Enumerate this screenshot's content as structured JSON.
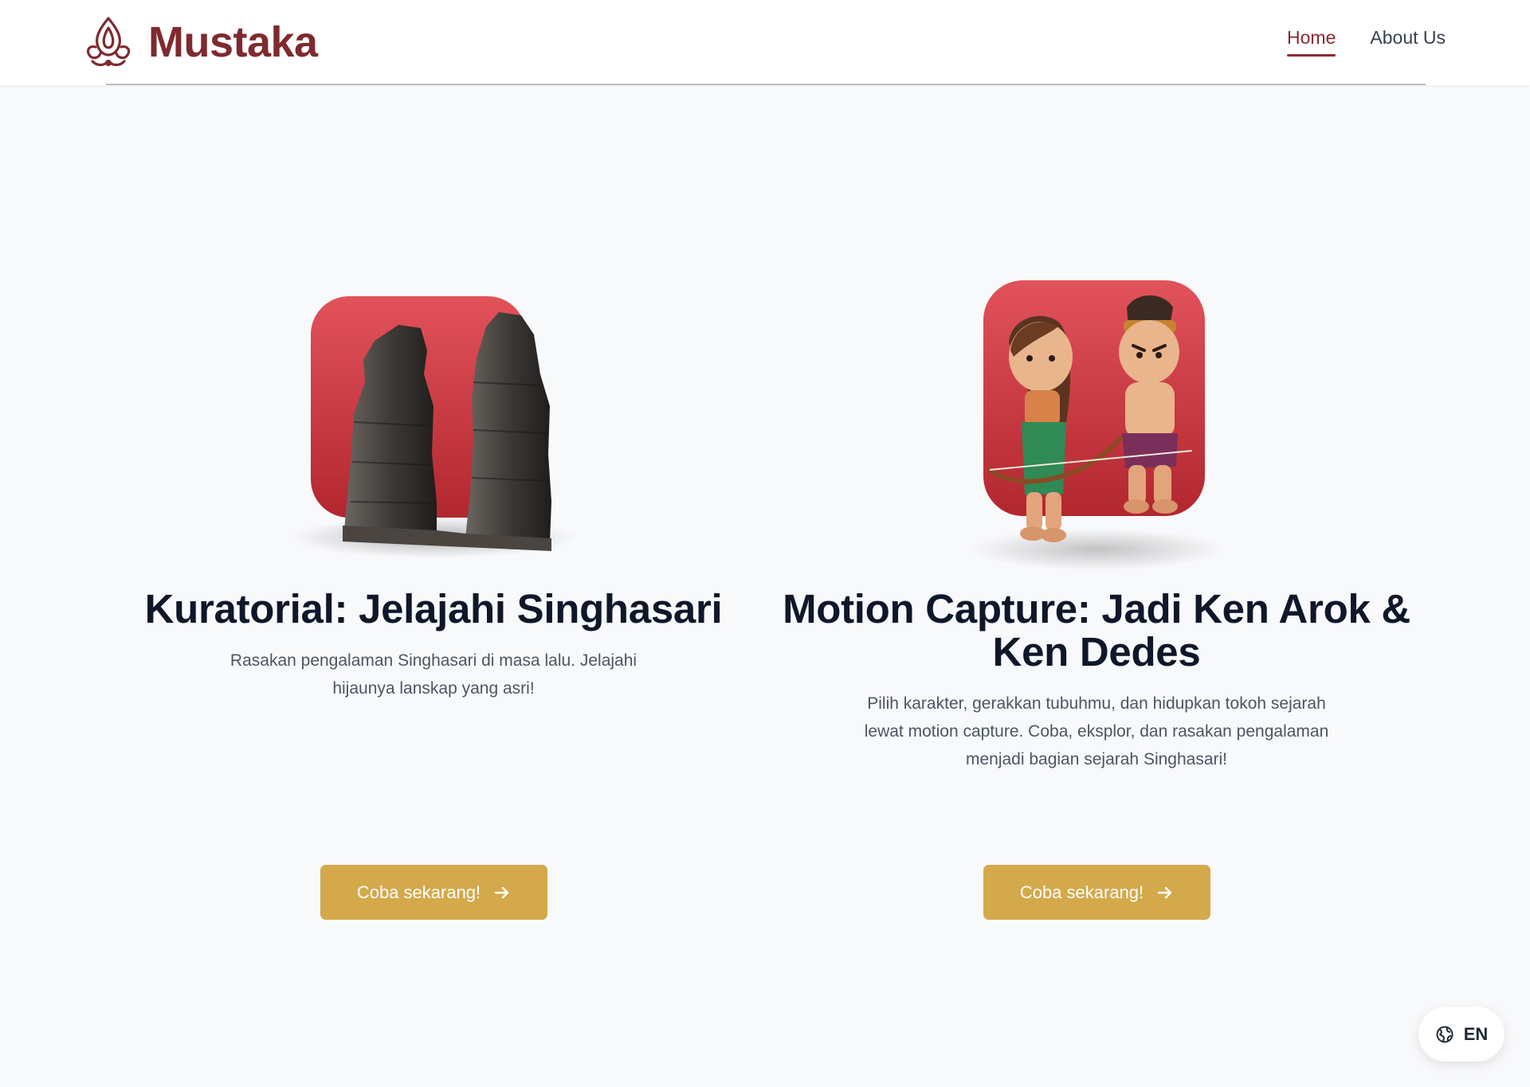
{
  "header": {
    "brand_name": "Mustaka",
    "logo_icon": "ornamental-flame-logo",
    "nav": [
      {
        "label": "Home",
        "active": true
      },
      {
        "label": "About Us",
        "active": false
      }
    ]
  },
  "cards": [
    {
      "illustration": "temple-ruins-icon",
      "title": "Kuratorial: Jelajahi Singhasari",
      "description": "Rasakan pengalaman Singhasari di masa lalu. Jelajahi hijaunya lanskap yang asri!",
      "cta_label": "Coba sekarang!"
    },
    {
      "illustration": "ken-arok-ken-dedes-characters-icon",
      "title": "Motion Capture: Jadi Ken Arok & Ken Dedes",
      "description": "Pilih karakter, gerakkan tubuhmu, dan hidupkan tokoh sejarah lewat motion capture. Coba, eksplor, dan rasakan pengalaman menjadi bagian sejarah Singhasari!",
      "cta_label": "Coba sekarang!"
    }
  ],
  "language_toggle": {
    "label": "EN",
    "icon": "globe-icon"
  },
  "colors": {
    "brand": "#7e2a2f",
    "accent_button": "#d3a94b",
    "tile_red": "#dc4b55",
    "background": "#f8f9fb"
  }
}
